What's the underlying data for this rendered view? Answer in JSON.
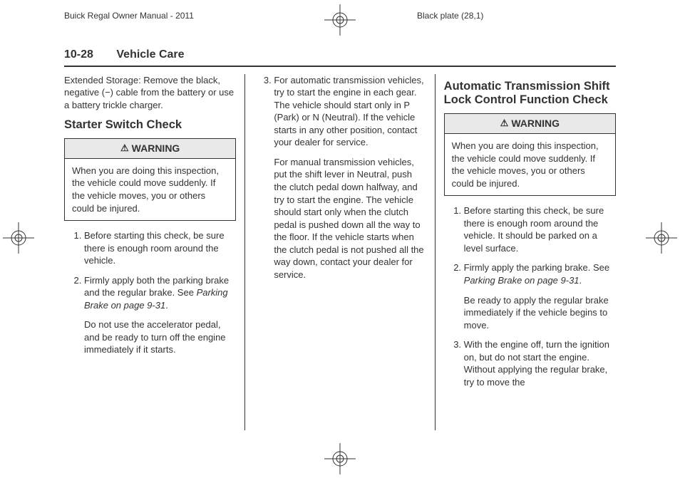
{
  "meta": {
    "topLeft": "Buick Regal Owner Manual - 2011",
    "topRight": "Black plate (28,1)"
  },
  "sectionHead": {
    "num": "10-28",
    "title": "Vehicle Care"
  },
  "col1": {
    "intro": "Extended Storage: Remove the black, negative (−) cable from the battery or use a battery trickle charger.",
    "h2": "Starter Switch Check",
    "warningLabel": "WARNING",
    "warningBody": "When you are doing this inspection, the vehicle could move suddenly. If the vehicle moves, you or others could be injured.",
    "li1": "Before starting this check, be sure there is enough room around the vehicle.",
    "li2a": "Firmly apply both the parking brake and the regular brake. See ",
    "li2italic": "Parking Brake on page 9‑31",
    "li2b": ".",
    "li2p2": "Do not use the accelerator pedal, and be ready to turn off the engine immediately if it starts."
  },
  "col2": {
    "li3p1": "For automatic transmission vehicles, try to start the engine in each gear. The vehicle should start only in P (Park) or N (Neutral). If the vehicle starts in any other position, contact your dealer for service.",
    "li3p2": "For manual transmission vehicles, put the shift lever in Neutral, push the clutch pedal down halfway, and try to start the engine. The vehicle should start only when the clutch pedal is pushed down all the way to the floor. If the vehicle starts when the clutch pedal is not pushed all the way down, contact your dealer for service."
  },
  "col3": {
    "h2": "Automatic Transmission Shift Lock Control Function Check",
    "warningLabel": "WARNING",
    "warningBody": "When you are doing this inspection, the vehicle could move suddenly. If the vehicle moves, you or others could be injured.",
    "li1": "Before starting this check, be sure there is enough room around the vehicle. It should be parked on a level surface.",
    "li2a": "Firmly apply the parking brake. See ",
    "li2italic": "Parking Brake on page 9‑31",
    "li2b": ".",
    "li2p2": "Be ready to apply the regular brake immediately if the vehicle begins to move.",
    "li3": "With the engine off, turn the ignition on, but do not start the engine. Without applying the regular brake, try to move the"
  }
}
